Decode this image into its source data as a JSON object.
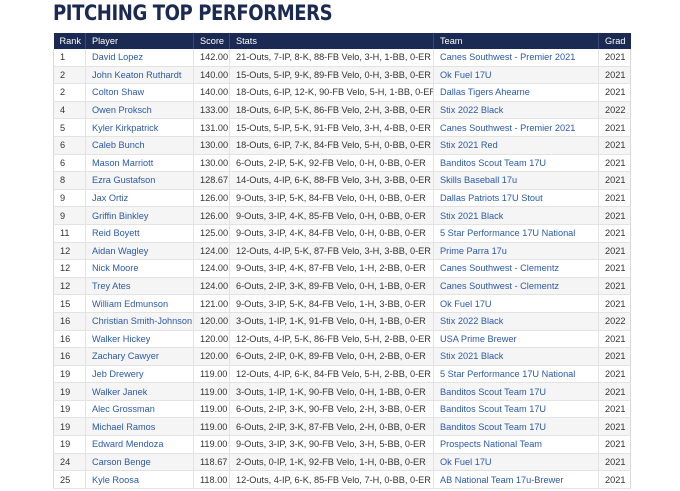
{
  "page": {
    "title": "PITCHING TOP PERFORMERS"
  },
  "table": {
    "headers": [
      "Rank",
      "Player",
      "Score",
      "Stats",
      "Team",
      "Grad"
    ],
    "rows": [
      {
        "rank": "1",
        "player": "David Lopez",
        "score": "142.00",
        "stats": "21-Outs, 7-IP, 8-K, 88-FB Velo, 3-H, 1-BB, 0-ER",
        "team": "Canes Southwest - Premier 2021",
        "grad": "2021"
      },
      {
        "rank": "2",
        "player": "John Keaton Ruthardt",
        "score": "140.00",
        "stats": "15-Outs, 5-IP, 9-K, 89-FB Velo, 0-H, 3-BB, 0-ER",
        "team": "Ok Fuel 17U",
        "grad": "2021"
      },
      {
        "rank": "2",
        "player": "Colton Shaw",
        "score": "140.00",
        "stats": "18-Outs, 6-IP, 12-K, 90-FB Velo, 5-H, 1-BB, 0-ER",
        "team": "Dallas Tigers Ahearne",
        "grad": "2021"
      },
      {
        "rank": "4",
        "player": "Owen Proksch",
        "score": "133.00",
        "stats": "18-Outs, 6-IP, 5-K, 86-FB Velo, 2-H, 3-BB, 0-ER",
        "team": "Stix 2022 Black",
        "grad": "2022"
      },
      {
        "rank": "5",
        "player": "Kyler Kirkpatrick",
        "score": "131.00",
        "stats": "15-Outs, 5-IP, 5-K, 91-FB Velo, 3-H, 4-BB, 0-ER",
        "team": "Canes Southwest - Premier 2021",
        "grad": "2021"
      },
      {
        "rank": "6",
        "player": "Caleb Bunch",
        "score": "130.00",
        "stats": "18-Outs, 6-IP, 7-K, 84-FB Velo, 5-H, 0-BB, 0-ER",
        "team": "Stix 2021 Red",
        "grad": "2021"
      },
      {
        "rank": "6",
        "player": "Mason Marriott",
        "score": "130.00",
        "stats": "6-Outs, 2-IP, 5-K, 92-FB Velo, 0-H, 0-BB, 0-ER",
        "team": "Banditos Scout Team 17U",
        "grad": "2021"
      },
      {
        "rank": "8",
        "player": "Ezra Gustafson",
        "score": "128.67",
        "stats": "14-Outs, 4-IP, 6-K, 88-FB Velo, 3-H, 3-BB, 0-ER",
        "team": "Skills Baseball 17u",
        "grad": "2021"
      },
      {
        "rank": "9",
        "player": "Jax Ortiz",
        "score": "126.00",
        "stats": "9-Outs, 3-IP, 5-K, 84-FB Velo, 0-H, 0-BB, 0-ER",
        "team": "Dallas Patriots 17U Stout",
        "grad": "2021"
      },
      {
        "rank": "9",
        "player": "Griffin Binkley",
        "score": "126.00",
        "stats": "9-Outs, 3-IP, 4-K, 85-FB Velo, 0-H, 0-BB, 0-ER",
        "team": "Stix 2021 Black",
        "grad": "2021"
      },
      {
        "rank": "11",
        "player": "Reid Boyett",
        "score": "125.00",
        "stats": "9-Outs, 3-IP, 4-K, 84-FB Velo, 0-H, 0-BB, 0-ER",
        "team": "5 Star Performance 17U National",
        "grad": "2021"
      },
      {
        "rank": "12",
        "player": "Aidan Wagley",
        "score": "124.00",
        "stats": "12-Outs, 4-IP, 5-K, 87-FB Velo, 3-H, 3-BB, 0-ER",
        "team": "Prime Parra 17u",
        "grad": "2021"
      },
      {
        "rank": "12",
        "player": "Nick Moore",
        "score": "124.00",
        "stats": "9-Outs, 3-IP, 4-K, 87-FB Velo, 1-H, 2-BB, 0-ER",
        "team": "Canes Southwest - Clementz",
        "grad": "2021"
      },
      {
        "rank": "12",
        "player": "Trey Ates",
        "score": "124.00",
        "stats": "6-Outs, 2-IP, 3-K, 89-FB Velo, 0-H, 1-BB, 0-ER",
        "team": "Canes Southwest - Clementz",
        "grad": "2021"
      },
      {
        "rank": "15",
        "player": "William Edmunson",
        "score": "121.00",
        "stats": "9-Outs, 3-IP, 5-K, 84-FB Velo, 1-H, 3-BB, 0-ER",
        "team": "Ok Fuel 17U",
        "grad": "2021"
      },
      {
        "rank": "16",
        "player": "Christian Smith-Johnson",
        "score": "120.00",
        "stats": "3-Outs, 1-IP, 1-K, 91-FB Velo, 0-H, 1-BB, 0-ER",
        "team": "Stix 2022 Black",
        "grad": "2022"
      },
      {
        "rank": "16",
        "player": "Walker Hickey",
        "score": "120.00",
        "stats": "12-Outs, 4-IP, 5-K, 86-FB Velo, 5-H, 2-BB, 0-ER",
        "team": "USA Prime Brewer",
        "grad": "2021"
      },
      {
        "rank": "16",
        "player": "Zachary Cawyer",
        "score": "120.00",
        "stats": "6-Outs, 2-IP, 0-K, 89-FB Velo, 0-H, 2-BB, 0-ER",
        "team": "Stix 2021 Black",
        "grad": "2021"
      },
      {
        "rank": "19",
        "player": "Jeb Drewery",
        "score": "119.00",
        "stats": "12-Outs, 4-IP, 6-K, 84-FB Velo, 5-H, 2-BB, 0-ER",
        "team": "5 Star Performance 17U National",
        "grad": "2021"
      },
      {
        "rank": "19",
        "player": "Walker Janek",
        "score": "119.00",
        "stats": "3-Outs, 1-IP, 1-K, 90-FB Velo, 0-H, 1-BB, 0-ER",
        "team": "Banditos Scout Team 17U",
        "grad": "2021"
      },
      {
        "rank": "19",
        "player": "Alec Grossman",
        "score": "119.00",
        "stats": "6-Outs, 2-IP, 3-K, 90-FB Velo, 2-H, 3-BB, 0-ER",
        "team": "Banditos Scout Team 17U",
        "grad": "2021"
      },
      {
        "rank": "19",
        "player": "Michael Ramos",
        "score": "119.00",
        "stats": "6-Outs, 2-IP, 3-K, 87-FB Velo, 2-H, 0-BB, 0-ER",
        "team": "Banditos Scout Team 17U",
        "grad": "2021"
      },
      {
        "rank": "19",
        "player": "Edward Mendoza",
        "score": "119.00",
        "stats": "9-Outs, 3-IP, 3-K, 90-FB Velo, 3-H, 5-BB, 0-ER",
        "team": "Prospects National Team",
        "grad": "2021"
      },
      {
        "rank": "24",
        "player": "Carson Benge",
        "score": "118.67",
        "stats": "2-Outs, 0-IP, 1-K, 92-FB Velo, 1-H, 0-BB, 0-ER",
        "team": "Ok Fuel 17U",
        "grad": "2021"
      },
      {
        "rank": "25",
        "player": "Kyle Roosa",
        "score": "118.00",
        "stats": "12-Outs, 4-IP, 6-K, 85-FB Velo, 7-H, 0-BB, 0-ER",
        "team": "AB National Team 17u-Brewer",
        "grad": "2021"
      }
    ]
  },
  "colors": {
    "header_bg": "#1b2a52",
    "title": "#1b2a52",
    "link": "#2b5aa8"
  }
}
